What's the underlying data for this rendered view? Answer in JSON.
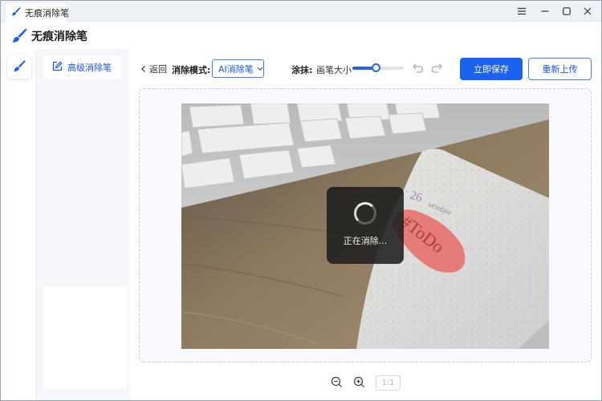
{
  "window": {
    "tab_title": "无痕消除笔",
    "controls": [
      "menu-icon",
      "minimize-icon",
      "maximize-icon",
      "close-icon"
    ]
  },
  "header": {
    "title": "无痕消除笔",
    "logo_icon": "brush-icon"
  },
  "rail": {
    "items": [
      {
        "icon": "brush-icon",
        "active": true
      }
    ]
  },
  "sidebar": {
    "items": [
      {
        "label": "高级消除笔",
        "icon": "edit-square-icon",
        "active": true
      }
    ]
  },
  "toolbar": {
    "back_label": "返回",
    "mode_label": "消除模式:",
    "mode_value": "AI消除笔",
    "brush_label": "涂抹:",
    "brush_size_label": "画笔大小",
    "brush_size_fraction": 0.45,
    "save_label": "立即保存",
    "reupload_label": "重新上传"
  },
  "canvas": {
    "image_subject": "keyboard and notebook photo",
    "notebook_date": "26",
    "notebook_day": "MONDAY",
    "notebook_note": "#ToDo",
    "status_text": "正在消除..."
  },
  "zoom": {
    "ratio_label": "1:1"
  },
  "colors": {
    "primary": "#1a62f0",
    "accent_text": "#1a56db",
    "mask": "#e8605c"
  }
}
